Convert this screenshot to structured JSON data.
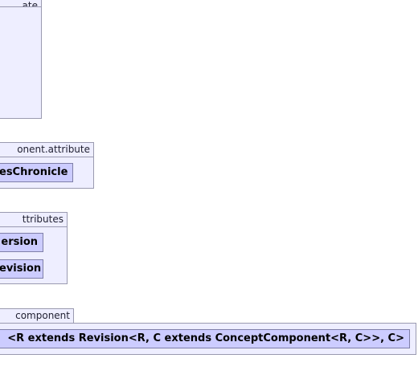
{
  "packages": [
    {
      "label": "ate",
      "classes": []
    },
    {
      "label": "onent.attribute",
      "classes": [
        "esChronicle"
      ]
    },
    {
      "label": "ttributes",
      "classes": [
        "ersion",
        "evision"
      ]
    },
    {
      "label": "component",
      "classes": [
        "<R extends Revision<R, C extends ConceptComponent<R, C>>, C>"
      ]
    }
  ],
  "colors": {
    "package_fill": "#eeeeff",
    "package_border": "#9a9ab0",
    "class_fill": "#ccccff",
    "class_border": "#7f7fa8"
  }
}
